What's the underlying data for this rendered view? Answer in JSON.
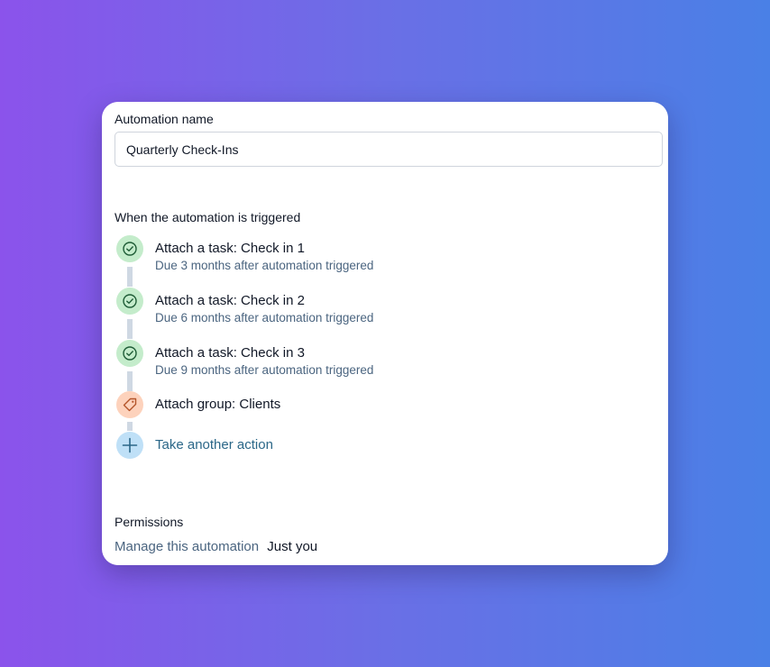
{
  "form": {
    "name_label": "Automation name",
    "name_value": "Quarterly Check-Ins",
    "trigger_heading": "When the automation is triggered"
  },
  "steps": [
    {
      "title": "Attach a task: Check in 1",
      "subtitle": "Due 3 months after automation triggered",
      "icon": "check-circle-icon",
      "color": "#c4eccb"
    },
    {
      "title": "Attach a task: Check in 2",
      "subtitle": "Due 6 months after automation triggered",
      "icon": "check-circle-icon",
      "color": "#c4eccb"
    },
    {
      "title": "Attach a task: Check in 3",
      "subtitle": "Due 9 months after automation triggered",
      "icon": "check-circle-icon",
      "color": "#c4eccb"
    },
    {
      "title": "Attach group: Clients",
      "icon": "tag-icon",
      "color": "#fdd2bc"
    }
  ],
  "add_action": {
    "label": "Take another action",
    "icon": "plus-icon",
    "color": "#bfe0f7"
  },
  "permissions": {
    "heading": "Permissions",
    "link_label": "Manage this automation",
    "value": "Just you"
  },
  "colors": {
    "accent_link": "#2b6788",
    "muted_text": "#4b6580"
  }
}
